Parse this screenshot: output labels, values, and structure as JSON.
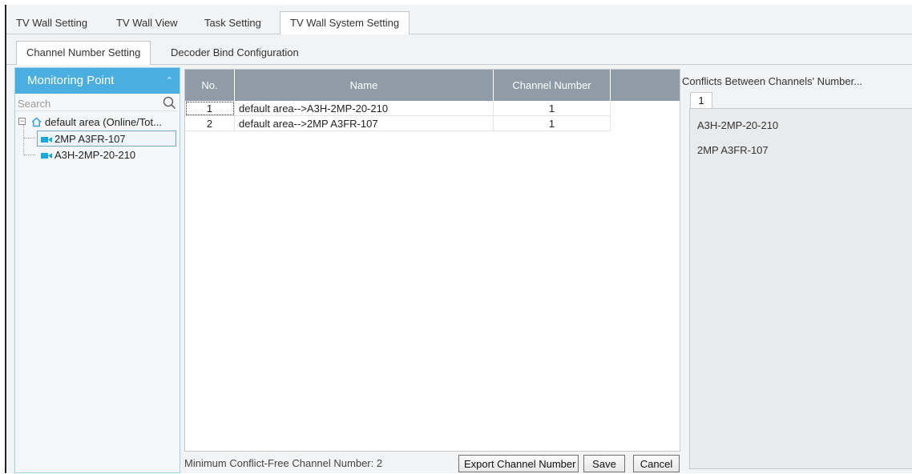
{
  "top_tabs": [
    "TV Wall Setting",
    "TV Wall View",
    "Task Setting",
    "TV Wall System Setting"
  ],
  "sub_tabs": [
    "Channel Number Setting",
    "Decoder Bind Configuration"
  ],
  "left_panel": {
    "title": "Monitoring Point",
    "search_placeholder": "Search",
    "tree": {
      "root": "default area (Online/Tot...",
      "children": [
        "2MP A3FR-107",
        "A3H-2MP-20-210"
      ]
    }
  },
  "table": {
    "headers": [
      "No.",
      "Name",
      "Channel Number"
    ],
    "rows": [
      {
        "no": "1",
        "name": "default area-->A3H-2MP-20-210",
        "channel": "1"
      },
      {
        "no": "2",
        "name": "default area-->2MP A3FR-107",
        "channel": "1"
      }
    ]
  },
  "footer": {
    "min_label": "Minimum Conflict-Free Channel Number: 2",
    "export_button": "Export Channel Number",
    "save_button": "Save",
    "cancel_button": "Cancel"
  },
  "conflicts": {
    "title": "Conflicts Between Channels' Number...",
    "tab": "1",
    "items": [
      "A3H-2MP-20-210",
      "2MP A3FR-107"
    ]
  },
  "colors": {
    "panel_header": "#4aaee0",
    "table_header": "#8f9ca7",
    "camera_icon": "#19a9e0",
    "home_icon": "#2a9fd6"
  }
}
